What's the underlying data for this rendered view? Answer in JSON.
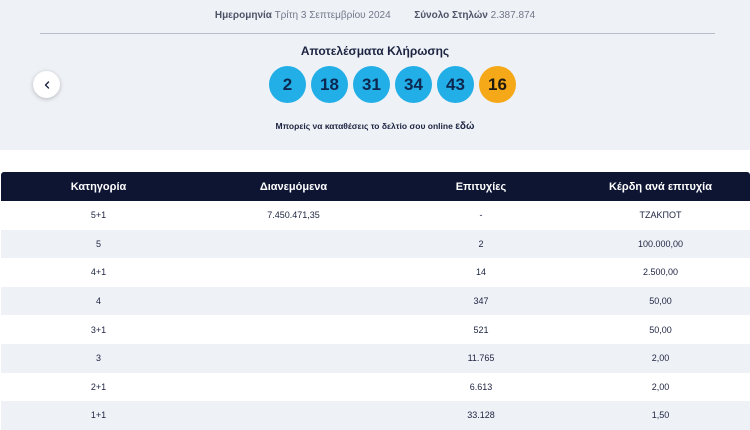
{
  "draw_info": {
    "date_label": "Ημερομηνία",
    "date_value": "Τρίτη 3 Σεπτεμβρίου 2024",
    "total_label": "Σύνολο Στηλών",
    "total_value": "2.387.874"
  },
  "results": {
    "title": "Αποτελέσματα Κλήρωσης",
    "numbers": [
      "2",
      "18",
      "31",
      "34",
      "43"
    ],
    "joker": "16",
    "online_text": "Μπορείς να καταθέσεις το δελτίο σου online",
    "online_link": "εδώ"
  },
  "colors": {
    "number_ball": "#22aee6",
    "joker_ball": "#f5a818",
    "header_bg": "#0d1533"
  },
  "table": {
    "headers": [
      "Κατηγορία",
      "Διανεμόμενα",
      "Επιτυχίες",
      "Κέρδη ανά επιτυχία"
    ],
    "rows": [
      [
        "5+1",
        "7.450.471,35",
        "-",
        "ΤΖΑΚΠΟΤ"
      ],
      [
        "5",
        "",
        "2",
        "100.000,00"
      ],
      [
        "4+1",
        "",
        "14",
        "2.500,00"
      ],
      [
        "4",
        "",
        "347",
        "50,00"
      ],
      [
        "3+1",
        "",
        "521",
        "50,00"
      ],
      [
        "3",
        "",
        "11.765",
        "2,00"
      ],
      [
        "2+1",
        "",
        "6.613",
        "2,00"
      ],
      [
        "1+1",
        "",
        "33.128",
        "1,50"
      ]
    ]
  }
}
